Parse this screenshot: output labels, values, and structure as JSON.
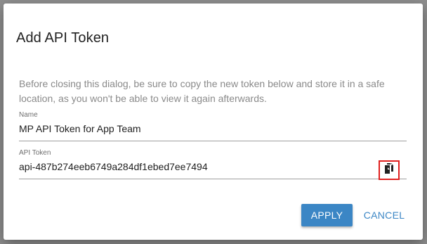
{
  "dialog": {
    "title": "Add API Token",
    "hint": "Before closing this dialog, be sure to copy the new token below and store it in a safe location, as you won't be able to view it again afterwards."
  },
  "fields": {
    "name": {
      "label": "Name",
      "value": "MP API Token for App Team"
    },
    "token": {
      "label": "API Token",
      "value": "api-487b274eeb6749a284df1ebed7ee7494",
      "copy_icon": "copy-icon"
    }
  },
  "actions": {
    "apply_label": "APPLY",
    "cancel_label": "CANCEL"
  },
  "colors": {
    "accent": "#3b86c5",
    "highlight": "#e0201f",
    "overlay": "#8e8e8e"
  }
}
